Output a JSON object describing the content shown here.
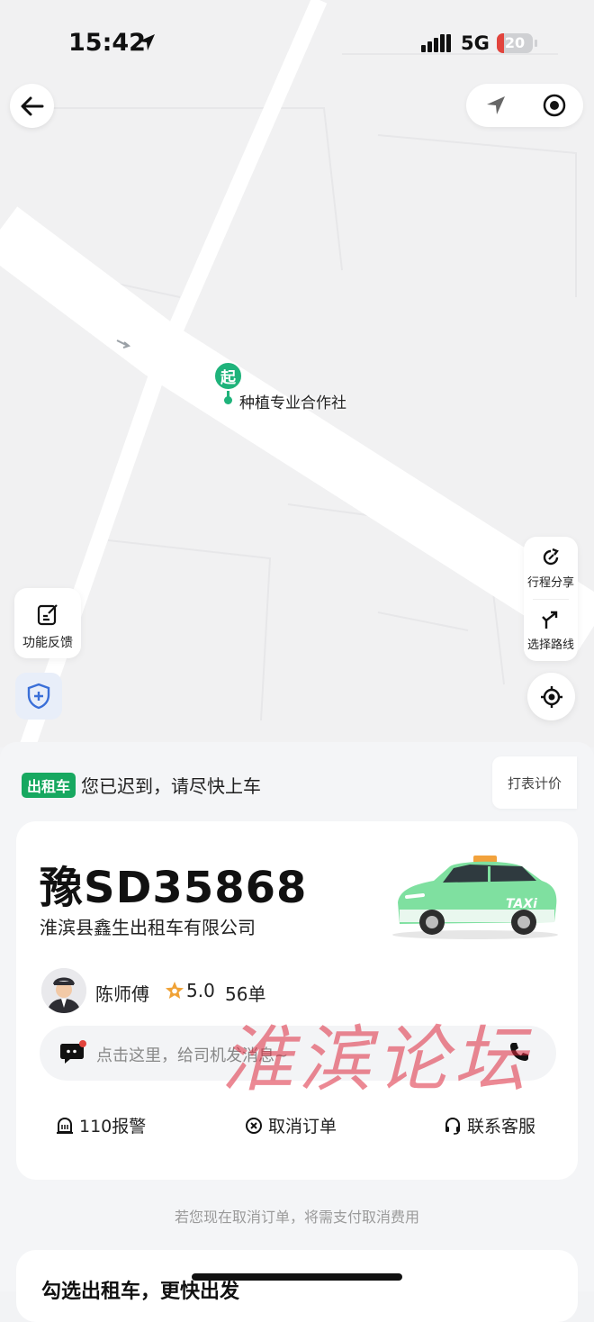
{
  "status_bar": {
    "time": "15:42",
    "network": "5G",
    "battery": "20",
    "battery_level": 0.2
  },
  "map": {
    "pin_badge": "起",
    "pickup_label": "种植专业合作社"
  },
  "map_tools": {
    "feedback_label": "功能反馈",
    "share_label": "行程分享",
    "route_label": "选择路线"
  },
  "trip": {
    "service_tag": "出租车",
    "status_message": "您已迟到，请尽快上车",
    "meter_label": "打表计价"
  },
  "driver_card": {
    "plate": "豫SD35868",
    "company": "淮滨县鑫生出租车有限公司",
    "driver_name": "陈师傅",
    "rating": "5.0",
    "orders": "56单",
    "message_placeholder": "点击这里，给司机发消息~",
    "actions": {
      "police": "110报警",
      "cancel": "取消订单",
      "service": "联系客服"
    }
  },
  "hint": "若您现在取消订单，将需支付取消费用",
  "bottom_card": {
    "title": "勾选出租车，更快出发"
  },
  "watermark": "淮滨论坛",
  "colors": {
    "brand_green": "#17a860",
    "pin_green": "#1fb37b",
    "battery_low": "#e2443d"
  }
}
